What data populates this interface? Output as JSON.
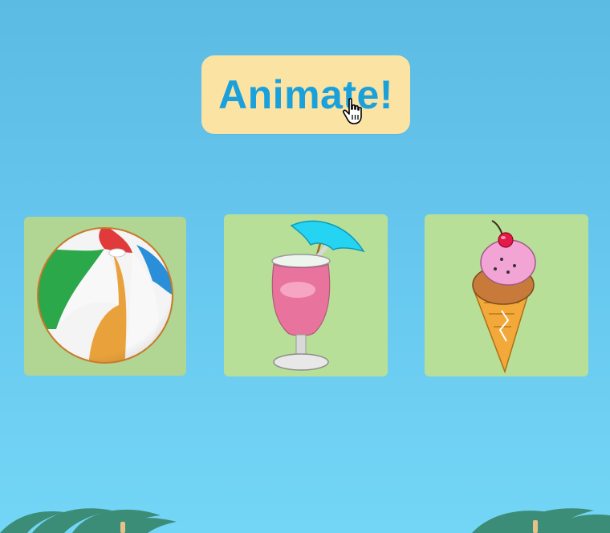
{
  "controls": {
    "animate_label": "Animate!"
  },
  "cards": [
    {
      "name": "beach-ball",
      "icon": "beach-ball-icon"
    },
    {
      "name": "pink-drink",
      "icon": "pink-drink-icon"
    },
    {
      "name": "ice-cream",
      "icon": "ice-cream-icon"
    }
  ],
  "colors": {
    "sky_top": "#5bbbe3",
    "sky_bottom": "#74d6f6",
    "button_bg": "#fbe3a4",
    "button_text": "#1aa1dc",
    "card_bg": "#b8df98"
  }
}
